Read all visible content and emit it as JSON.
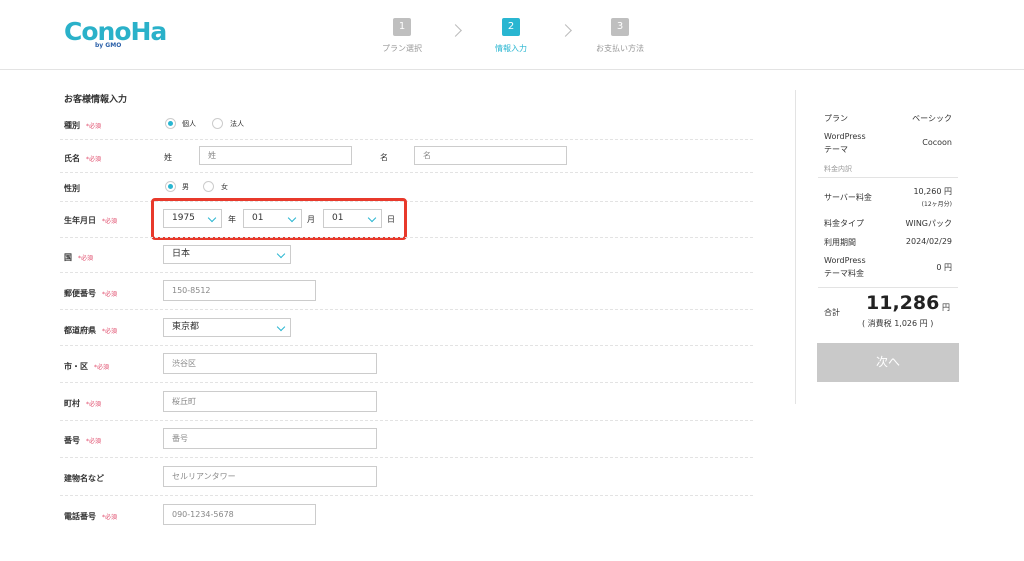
{
  "header": {
    "logo": "ConoHa",
    "logo_sub": "by GMO",
    "steps": [
      {
        "num": "1",
        "label": "プラン選択"
      },
      {
        "num": "2",
        "label": "情報入力"
      },
      {
        "num": "3",
        "label": "お支払い方法"
      }
    ]
  },
  "form": {
    "title": "お客様情報入力",
    "required": "*必須",
    "type": {
      "label": "種別",
      "options": [
        "個人",
        "法人"
      ],
      "selected": "個人"
    },
    "name": {
      "label": "氏名",
      "last_label": "姓",
      "last_placeholder": "姓",
      "first_label": "名",
      "first_placeholder": "名"
    },
    "gender": {
      "label": "性別",
      "options": [
        "男",
        "女"
      ],
      "selected": "男"
    },
    "birthday": {
      "label": "生年月日",
      "year": "1975",
      "year_unit": "年",
      "month": "01",
      "month_unit": "月",
      "day": "01",
      "day_unit": "日"
    },
    "country": {
      "label": "国",
      "value": "日本"
    },
    "zip": {
      "label": "郵便番号",
      "placeholder": "150-8512"
    },
    "prefecture": {
      "label": "都道府県",
      "value": "東京都"
    },
    "city": {
      "label": "市・区",
      "placeholder": "渋谷区"
    },
    "town": {
      "label": "町村",
      "placeholder": "桜丘町"
    },
    "number": {
      "label": "番号",
      "placeholder": "番号"
    },
    "building": {
      "label": "建物名など",
      "placeholder": "セルリアンタワー"
    },
    "phone": {
      "label": "電話番号",
      "placeholder": "090-1234-5678"
    }
  },
  "summary": {
    "plan_label": "プラン",
    "plan_value": "ベーシック",
    "theme_label_1": "WordPress",
    "theme_label_2": "テーマ",
    "theme_value": "Cocoon",
    "breakdown_label": "料金内訳",
    "server_fee_label": "サーバー料金",
    "server_fee_value": "10,260 円",
    "server_fee_note": "(12ヶ月分)",
    "fee_type_label": "料金タイプ",
    "fee_type_value": "WINGパック",
    "period_label": "利用期間",
    "period_value": "2024/02/29",
    "theme_fee_label_1": "WordPress",
    "theme_fee_label_2": "テーマ料金",
    "theme_fee_value": "0 円",
    "total_label": "合計",
    "total_value": "11,286",
    "total_unit": "円",
    "tax_note": "( 消費税 1,026 円 )",
    "next_button": "次へ"
  }
}
